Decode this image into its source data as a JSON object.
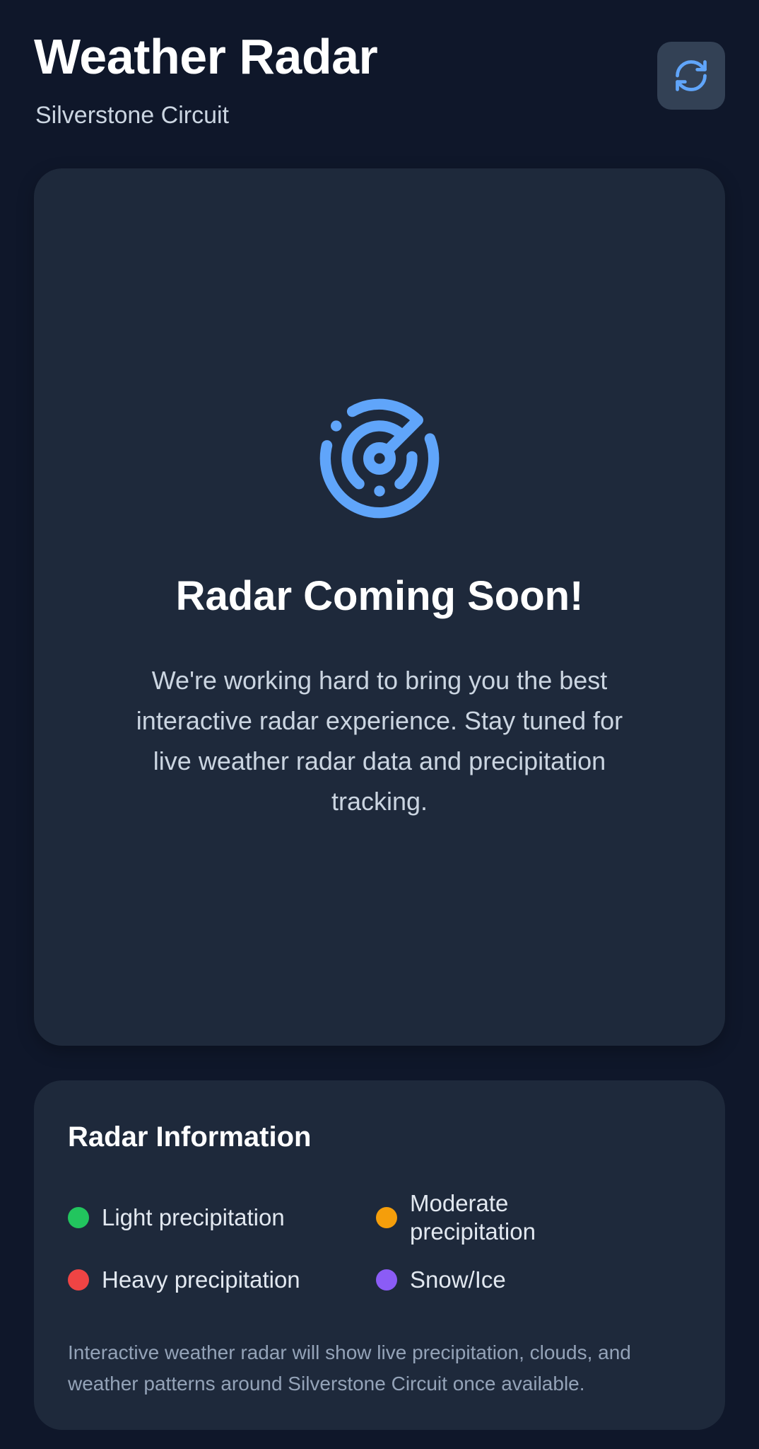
{
  "header": {
    "title": "Weather Radar",
    "subtitle": "Silverstone Circuit",
    "refresh_icon": "refresh-icon"
  },
  "main_card": {
    "icon": "radar-icon",
    "title": "Radar Coming Soon!",
    "description": "We're working hard to bring you the best interactive radar experience. Stay tuned for live weather radar data and precipitation tracking."
  },
  "info": {
    "title": "Radar Information",
    "legend": [
      {
        "label": "Light precipitation",
        "color": "#22c55e"
      },
      {
        "label": "Moderate precipitation",
        "color": "#f59e0b"
      },
      {
        "label": "Heavy precipitation",
        "color": "#ef4444"
      },
      {
        "label": "Snow/Ice",
        "color": "#8b5cf6"
      }
    ],
    "note": "Interactive weather radar will show live precipitation, clouds, and weather patterns around Silverstone Circuit once available."
  },
  "colors": {
    "background": "#0f172a",
    "card": "#1e293b",
    "accent": "#60a5fa",
    "button": "#334155"
  }
}
